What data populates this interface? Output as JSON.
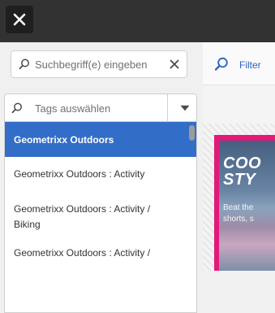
{
  "header": {
    "close_icon": "close-icon"
  },
  "search": {
    "placeholder": "Suchbegriff(e) eingeben"
  },
  "tags": {
    "placeholder": "Tags auswählen",
    "options": [
      "Geometrixx Outdoors",
      "Geometrixx Outdoors : Activity",
      "Geometrixx Outdoors : Activity / Biking",
      "Geometrixx Outdoors : Activity /"
    ],
    "selected_index": 0
  },
  "filter": {
    "label": "Filter"
  },
  "card": {
    "title": "COO\nSTY",
    "subtitle": "Beat the\nshorts, s"
  },
  "colors": {
    "topbar": "#323232",
    "selected": "#326ec8",
    "accent": "#2b63c5",
    "card_border": "#e2197b"
  }
}
